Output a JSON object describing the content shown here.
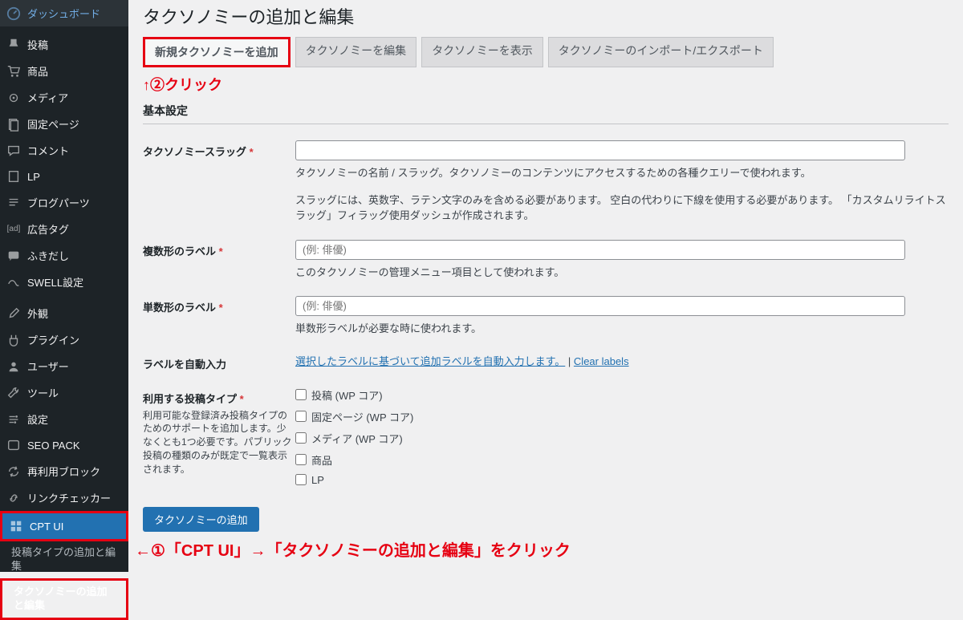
{
  "sidebar": {
    "items": [
      {
        "icon": "dashboard",
        "label": "ダッシュボード"
      },
      {
        "icon": "pin",
        "label": "投稿"
      },
      {
        "icon": "cart",
        "label": "商品"
      },
      {
        "icon": "media",
        "label": "メディア"
      },
      {
        "icon": "page",
        "label": "固定ページ"
      },
      {
        "icon": "comment",
        "label": "コメント"
      },
      {
        "icon": "page",
        "label": "LP"
      },
      {
        "icon": "text",
        "label": "ブログパーツ"
      },
      {
        "icon": "ad",
        "label": "広告タグ"
      },
      {
        "icon": "chat",
        "label": "ふきだし"
      },
      {
        "icon": "swell",
        "label": "SWELL設定"
      },
      {
        "icon": "brush",
        "label": "外観"
      },
      {
        "icon": "plugin",
        "label": "プラグイン"
      },
      {
        "icon": "user",
        "label": "ユーザー"
      },
      {
        "icon": "tool",
        "label": "ツール"
      },
      {
        "icon": "settings",
        "label": "設定"
      },
      {
        "icon": "seo",
        "label": "SEO PACK"
      },
      {
        "icon": "reuse",
        "label": "再利用ブロック"
      },
      {
        "icon": "link",
        "label": "リンクチェッカー"
      },
      {
        "icon": "cpt",
        "label": "CPT UI"
      }
    ],
    "submenu": {
      "add_post_type": "投稿タイプの追加と編集",
      "add_taxonomy": "タクソノミーの追加と編集"
    }
  },
  "page": {
    "title": "タクソノミーの追加と編集",
    "tabs": [
      "新規タクソノミーを追加",
      "タクソノミーを編集",
      "タクソノミーを表示",
      "タクソノミーのインポート/エクスポート"
    ],
    "section_basic": "基本設定"
  },
  "annot": {
    "step2": "↑②クリック",
    "step1": "←①「CPT UI」→「タクソノミーの追加と編集」をクリック"
  },
  "fields": {
    "slug": {
      "label": "タクソノミースラッグ",
      "desc1": "タクソノミーの名前 / スラッグ。タクソノミーのコンテンツにアクセスするための各種クエリーで使われます。",
      "desc2": "スラッグには、英数字、ラテン文字のみを含める必要があります。 空白の代わりに下線を使用する必要があります。 「カスタムリライトスラッグ」フィラッグ使用ダッシュが作成されます。"
    },
    "plural": {
      "label": "複数形のラベル",
      "placeholder": "(例: 俳優)",
      "desc": "このタクソノミーの管理メニュー項目として使われます。"
    },
    "singular": {
      "label": "単数形のラベル",
      "placeholder": "(例: 俳優)",
      "desc": "単数形ラベルが必要な時に使われます。"
    },
    "auto": {
      "label": "ラベルを自動入力",
      "link1": "選択したラベルに基づいて追加ラベルを自動入力します。",
      "sep": " | ",
      "link2": "Clear labels"
    },
    "post_types": {
      "label": "利用する投稿タイプ",
      "help": "利用可能な登録済み投稿タイプのためのサポートを追加します。少なくとも1つ必要です。パブリック投稿の種類のみが既定で一覧表示されます。",
      "options": [
        "投稿 (WP コア)",
        "固定ページ (WP コア)",
        "メディア (WP コア)",
        "商品",
        "LP"
      ]
    }
  },
  "submit": "タクソノミーの追加"
}
